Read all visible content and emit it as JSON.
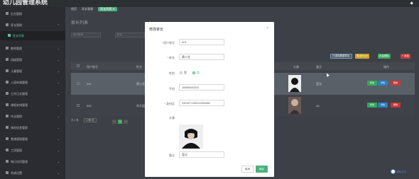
{
  "app": {
    "brand": "幼儿园管理系统"
  },
  "colors": {
    "accent": "#48b07e",
    "danger": "#c63838",
    "primary": "#2f7fc2",
    "warning": "#c9a524"
  },
  "breadcrumb": {
    "home": "首页",
    "section": "家长管理",
    "tab": "家长列表 ✕"
  },
  "page": {
    "title": "家长列表"
  },
  "search": {
    "field1_placeholder": "用户账号",
    "field2_placeholder": "姓名"
  },
  "sidebar": {
    "items": [
      {
        "label": "后台管理",
        "icon": "grid-icon"
      },
      {
        "label": "家长管理",
        "icon": "user-icon"
      },
      {
        "label": "家长列表",
        "icon": "list-icon",
        "active": true
      },
      {
        "label": "教师管理",
        "icon": "user-icon"
      },
      {
        "label": "班级管理",
        "icon": "grid-icon"
      },
      {
        "label": "儿童管理",
        "icon": "grid-icon"
      },
      {
        "label": "入园申请管理",
        "icon": "grid-icon"
      },
      {
        "label": "工作日志管理",
        "icon": "grid-icon"
      },
      {
        "label": "课程安排管理",
        "icon": "grid-icon"
      },
      {
        "label": "作业管理",
        "icon": "grid-icon"
      },
      {
        "label": "体检信息管理",
        "icon": "grid-icon"
      },
      {
        "label": "食谱管理管理",
        "icon": "grid-icon"
      },
      {
        "label": "工资管理",
        "icon": "grid-icon"
      },
      {
        "label": "每日访问管理",
        "icon": "grid-icon"
      },
      {
        "label": "系统设置",
        "icon": "gear-icon"
      }
    ]
  },
  "toolbar": {
    "btn1": "已选择数据导出",
    "btn2": "导出Excel",
    "btn3": "批量删除",
    "btn4": "+ 添加"
  },
  "table": {
    "columns": [
      "用户账号",
      "姓名",
      "头像",
      "备注",
      "操作"
    ],
    "rows": [
      {
        "account": "001",
        "name": "黄小芝",
        "remark": "暂无"
      },
      {
        "account": "002",
        "name": "刘大姐",
        "remark": "dd"
      }
    ],
    "row_actions": {
      "edit": "修改",
      "view": "详情",
      "delete": "删除"
    }
  },
  "pagination": {
    "total": "共 2 条",
    "page_size": "10条/页",
    "prev": "‹",
    "page": "1",
    "next": "›"
  },
  "help": {
    "label": "帮助文档"
  },
  "modal": {
    "title": "修改家长",
    "fields": {
      "account_label": "用户账号",
      "account_value": "001",
      "name_label": "姓名",
      "name_value": "黄小芝",
      "gender_label": "性别",
      "gender_male": "男",
      "gender_female": "女",
      "phone_label": "手机",
      "phone_value": "18556482231",
      "idcard_label": "身份证",
      "idcard_value": "330327199911553456",
      "avatar_label": "头像",
      "remark_label": "备注",
      "remark_value": "暂无"
    },
    "cancel_label": "取消",
    "ok_label": "确定"
  }
}
